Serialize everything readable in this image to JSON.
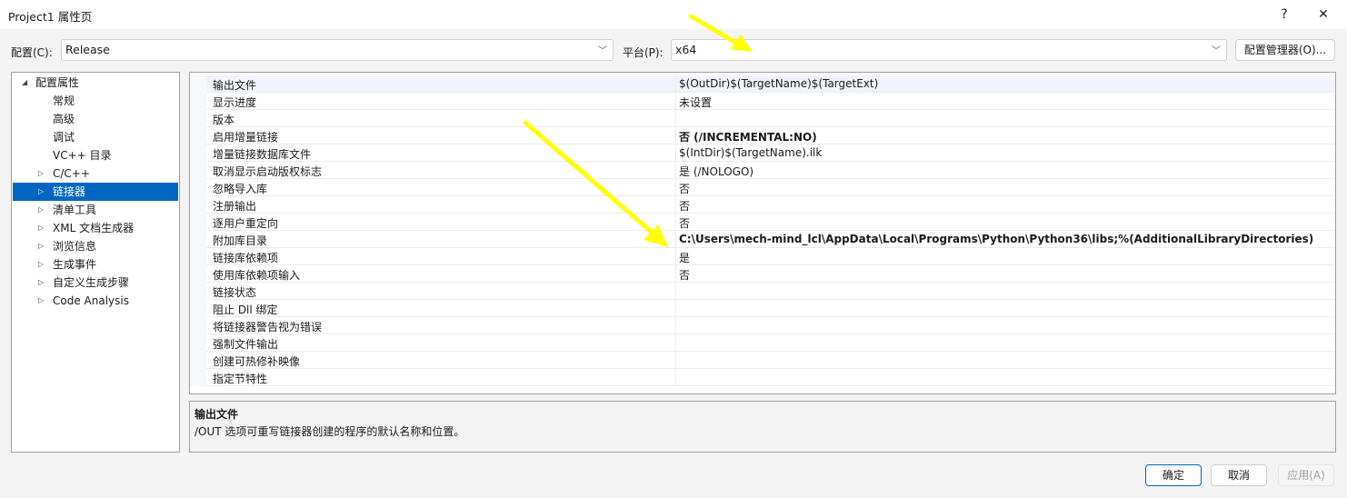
{
  "window": {
    "title": "Project1 属性页",
    "help": "?",
    "close": "✕"
  },
  "toolbar": {
    "config_label": "配置(C):",
    "config_value": "Release",
    "platform_label": "平台(P):",
    "platform_value": "x64",
    "config_manager": "配置管理器(O)..."
  },
  "tree": {
    "items": [
      {
        "label": "配置属性",
        "arrow": "◢",
        "indent": 0
      },
      {
        "label": "常规",
        "arrow": "",
        "indent": 1
      },
      {
        "label": "高级",
        "arrow": "",
        "indent": 1
      },
      {
        "label": "调试",
        "arrow": "",
        "indent": 1
      },
      {
        "label": "VC++ 目录",
        "arrow": "",
        "indent": 1
      },
      {
        "label": "C/C++",
        "arrow": "▷",
        "indent": 1
      },
      {
        "label": "链接器",
        "arrow": "▷",
        "indent": 1,
        "selected": true
      },
      {
        "label": "清单工具",
        "arrow": "▷",
        "indent": 1
      },
      {
        "label": "XML 文档生成器",
        "arrow": "▷",
        "indent": 1
      },
      {
        "label": "浏览信息",
        "arrow": "▷",
        "indent": 1
      },
      {
        "label": "生成事件",
        "arrow": "▷",
        "indent": 1
      },
      {
        "label": "自定义生成步骤",
        "arrow": "▷",
        "indent": 1
      },
      {
        "label": "Code Analysis",
        "arrow": "▷",
        "indent": 1
      }
    ]
  },
  "properties": [
    {
      "name": "输出文件",
      "value": "$(OutDir)$(TargetName)$(TargetExt)"
    },
    {
      "name": "显示进度",
      "value": "未设置"
    },
    {
      "name": "版本",
      "value": ""
    },
    {
      "name": "启用增量链接",
      "value": "否 (/INCREMENTAL:NO)",
      "bold": true
    },
    {
      "name": "增量链接数据库文件",
      "value": "$(IntDir)$(TargetName).ilk"
    },
    {
      "name": "取消显示启动版权标志",
      "value": "是 (/NOLOGO)"
    },
    {
      "name": "忽略导入库",
      "value": "否"
    },
    {
      "name": "注册输出",
      "value": "否"
    },
    {
      "name": "逐用户重定向",
      "value": "否"
    },
    {
      "name": "附加库目录",
      "value": "C:\\Users\\mech-mind_lcl\\AppData\\Local\\Programs\\Python\\Python36\\libs;%(AdditionalLibraryDirectories)",
      "bold": true
    },
    {
      "name": "链接库依赖项",
      "value": "是"
    },
    {
      "name": "使用库依赖项输入",
      "value": "否"
    },
    {
      "name": "链接状态",
      "value": ""
    },
    {
      "name": "阻止 Dll 绑定",
      "value": ""
    },
    {
      "name": "将链接器警告视为错误",
      "value": ""
    },
    {
      "name": "强制文件输出",
      "value": ""
    },
    {
      "name": "创建可热修补映像",
      "value": ""
    },
    {
      "name": "指定节特性",
      "value": ""
    }
  ],
  "description": {
    "title": "输出文件",
    "text": "/OUT 选项可重写链接器创建的程序的默认名称和位置。"
  },
  "footer": {
    "ok": "确定",
    "cancel": "取消",
    "apply": "应用(A)"
  },
  "colors": {
    "accent": "#0067c0",
    "annotation_arrow": "#ffff00"
  }
}
